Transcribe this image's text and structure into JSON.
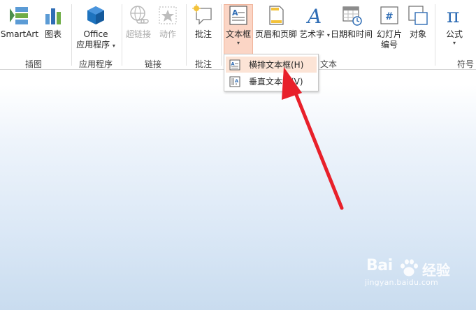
{
  "ribbon": {
    "buttons": {
      "smartart": "SmartArt",
      "chart": "图表",
      "office_apps_line1": "Office",
      "office_apps_line2": "应用程序",
      "hyperlink": "超链接",
      "action": "动作",
      "comment": "批注",
      "textbox": "文本框",
      "header_footer": "页眉和页脚",
      "wordart": "艺术字",
      "date_time": "日期和时间",
      "slide_number_line1": "幻灯片",
      "slide_number_line2": "编号",
      "object": "对象",
      "equation": "公式"
    },
    "groups": {
      "illustrations": "插图",
      "apps": "应用程序",
      "links": "链接",
      "comments": "批注",
      "text": "文本",
      "symbols": "符号"
    },
    "dropdown_caret": "▾"
  },
  "dropdown": {
    "horizontal_textbox": "横排文本框(H)",
    "vertical_textbox": "垂直文本框(V)"
  },
  "watermark": {
    "brand_left": "Bai",
    "brand_right": "经验",
    "url": "jingyan.baidu.com"
  },
  "colors": {
    "accent_orange": "#d24726",
    "highlight": "#fbd5c5",
    "arrow": "#e8202a",
    "blue_icon": "#2f6db5"
  }
}
